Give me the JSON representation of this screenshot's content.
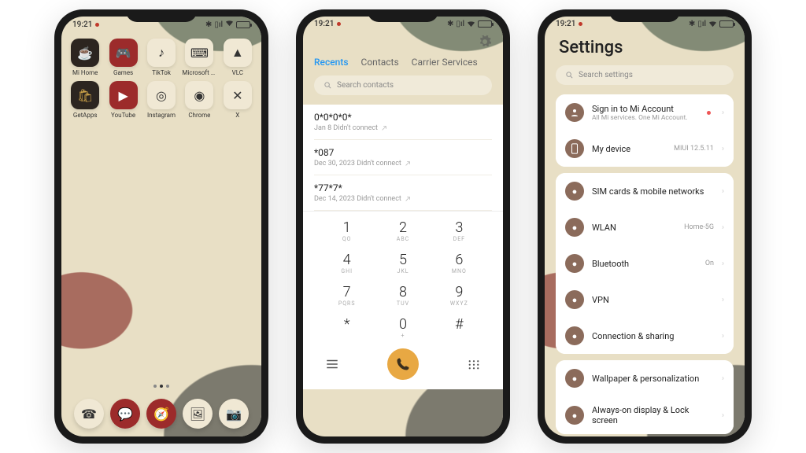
{
  "statusbar": {
    "time": "19:21"
  },
  "home": {
    "apps": [
      {
        "label": "Mi Home",
        "glyph": "☕",
        "tone": "dark"
      },
      {
        "label": "Games",
        "glyph": "🎮",
        "tone": "red"
      },
      {
        "label": "TikTok",
        "glyph": "♪",
        "tone": "cream"
      },
      {
        "label": "Microsoft SwiftKey ...",
        "glyph": "⌨",
        "tone": "cream"
      },
      {
        "label": "VLC",
        "glyph": "▲",
        "tone": "cream"
      },
      {
        "label": "GetApps",
        "glyph": "🛍",
        "tone": "dark"
      },
      {
        "label": "YouTube",
        "glyph": "▶",
        "tone": "red"
      },
      {
        "label": "Instagram",
        "glyph": "◎",
        "tone": "cream"
      },
      {
        "label": "Chrome",
        "glyph": "◉",
        "tone": "cream"
      },
      {
        "label": "X",
        "glyph": "✕",
        "tone": "cream"
      }
    ],
    "dock": [
      {
        "name": "phone-icon",
        "glyph": "☎",
        "tone": "cream"
      },
      {
        "name": "messages-icon",
        "glyph": "💬",
        "tone": "red"
      },
      {
        "name": "browser-icon",
        "glyph": "🧭",
        "tone": "red"
      },
      {
        "name": "gallery-icon",
        "glyph": "🖼",
        "tone": "cream"
      },
      {
        "name": "camera-icon",
        "glyph": "📷",
        "tone": "cream"
      }
    ]
  },
  "dialer": {
    "tabs": [
      "Recents",
      "Contacts",
      "Carrier Services"
    ],
    "search_placeholder": "Search contacts",
    "calls": [
      {
        "number": "0*0*0*0*",
        "meta": "Jan 8 Didn't connect"
      },
      {
        "number": "*087",
        "meta": "Dec 30, 2023 Didn't connect"
      },
      {
        "number": "*77*7*",
        "meta": "Dec 14, 2023 Didn't connect"
      }
    ],
    "keys": [
      {
        "d": "1",
        "s": "QO"
      },
      {
        "d": "2",
        "s": "ABC"
      },
      {
        "d": "3",
        "s": "DEF"
      },
      {
        "d": "4",
        "s": "GHI"
      },
      {
        "d": "5",
        "s": "JKL"
      },
      {
        "d": "6",
        "s": "MNO"
      },
      {
        "d": "7",
        "s": "PQRS"
      },
      {
        "d": "8",
        "s": "TUV"
      },
      {
        "d": "9",
        "s": "WXYZ"
      },
      {
        "d": "*",
        "s": ""
      },
      {
        "d": "0",
        "s": "+"
      },
      {
        "d": "#",
        "s": ""
      }
    ]
  },
  "settings": {
    "title": "Settings",
    "search_placeholder": "Search settings",
    "signin": {
      "label": "Sign in to Mi Account",
      "sub": "All Mi services. One Mi Account."
    },
    "device": {
      "label": "My device",
      "value": "MIUI 12.5.11"
    },
    "items": [
      {
        "label": "SIM cards & mobile networks",
        "value": "",
        "icon": "sim-icon"
      },
      {
        "label": "WLAN",
        "value": "Home-5G",
        "icon": "wifi-icon"
      },
      {
        "label": "Bluetooth",
        "value": "On",
        "icon": "bluetooth-icon"
      },
      {
        "label": "VPN",
        "value": "",
        "icon": "vpn-icon"
      },
      {
        "label": "Connection & sharing",
        "value": "",
        "icon": "share-icon"
      }
    ],
    "items2": [
      {
        "label": "Wallpaper & personalization",
        "icon": "wallpaper-icon"
      },
      {
        "label": "Always-on display & Lock screen",
        "icon": "lock-icon"
      }
    ]
  }
}
